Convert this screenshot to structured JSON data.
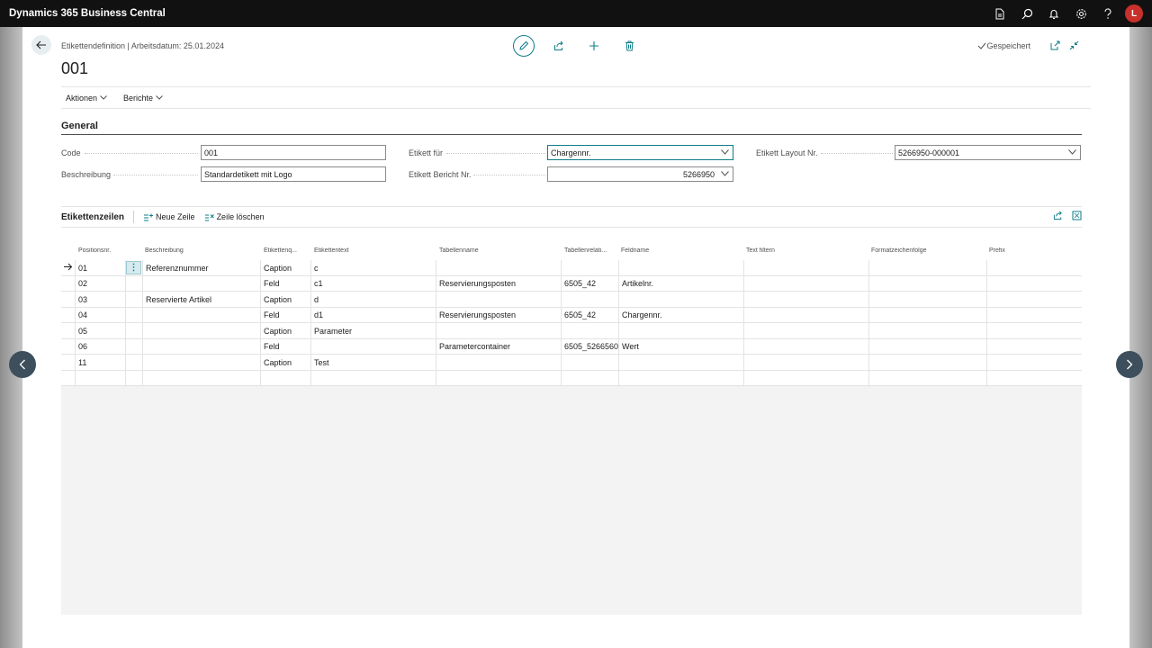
{
  "app": {
    "title": "Dynamics 365 Business Central",
    "user_initial": "L"
  },
  "page": {
    "breadcrumb": "Etikettendefinition | Arbeitsdatum: 25.01.2024",
    "record_title": "001",
    "saved_label": "Gespeichert"
  },
  "actions": {
    "aktionen": "Aktionen",
    "berichte": "Berichte"
  },
  "general": {
    "title": "General",
    "code_label": "Code",
    "code_value": "001",
    "beschreibung_label": "Beschreibung",
    "beschreibung_value": "Standardetikett mit Logo",
    "etikett_fuer_label": "Etikett für",
    "etikett_fuer_value": "Chargennr.",
    "etikett_bericht_label": "Etikett Bericht Nr.",
    "etikett_bericht_value": "5266950",
    "etikett_layout_label": "Etikett Layout Nr.",
    "etikett_layout_value": "5266950-000001"
  },
  "lines": {
    "title": "Etikettenzeilen",
    "new_line": "Neue Zeile",
    "delete_line": "Zeile löschen",
    "columns": [
      "Positionsnr.",
      "Beschreibung",
      "Etikettenq...",
      "Etikettentext",
      "Tabellenname",
      "Tabellenrelati...",
      "Feldname",
      "Text filtern",
      "Formatzeichenfolge",
      "Prefix"
    ],
    "rows": [
      [
        "01",
        "Referenznummer",
        "Caption",
        "c",
        "",
        "",
        ""
      ],
      [
        "02",
        "",
        "Feld",
        "c1",
        "Reservierungsposten",
        "6505_42",
        "Artikelnr."
      ],
      [
        "03",
        "Reservierte Artikel",
        "Caption",
        "d",
        "",
        "",
        ""
      ],
      [
        "04",
        "",
        "Feld",
        "d1",
        "Reservierungsposten",
        "6505_42",
        "Chargennr."
      ],
      [
        "05",
        "",
        "Caption",
        "Parameter",
        "",
        "",
        ""
      ],
      [
        "06",
        "",
        "Feld",
        "",
        "Parametercontainer",
        "6505_5266560",
        "Wert"
      ],
      [
        "11",
        "",
        "Caption",
        "Test",
        "",
        "",
        ""
      ],
      [
        "",
        "",
        "",
        "",
        "",
        "",
        ""
      ]
    ]
  },
  "colors": {
    "accent": "#0f7c8a",
    "appbar": "#111111",
    "avatar": "#c8302c"
  }
}
